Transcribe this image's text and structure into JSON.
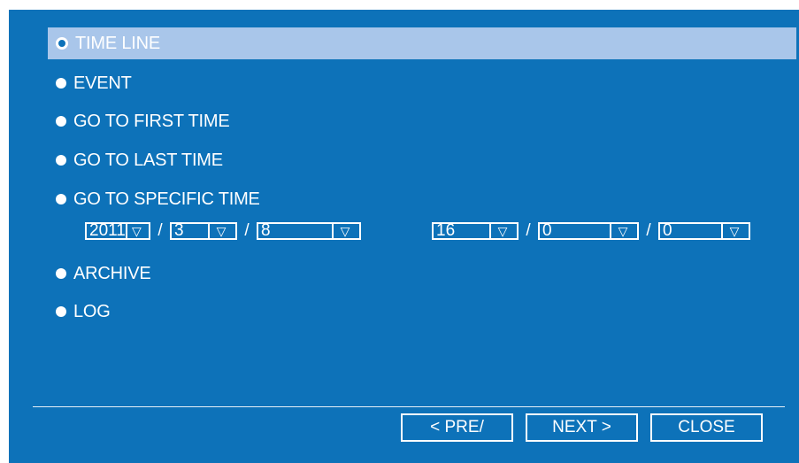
{
  "options": [
    {
      "label": "TIME LINE",
      "selected": true
    },
    {
      "label": "EVENT"
    },
    {
      "label": "GO TO FIRST TIME"
    },
    {
      "label": "GO TO LAST TIME"
    },
    {
      "label": "GO TO SPECIFIC TIME"
    },
    {
      "label": "ARCHIVE"
    },
    {
      "label": "LOG"
    }
  ],
  "date": {
    "year": "2011",
    "month": "3",
    "day": "8",
    "separator": "/"
  },
  "time": {
    "hour": "16",
    "minute": "0",
    "second": "0",
    "separator": "/"
  },
  "buttons": {
    "prev": "< PRE/",
    "next": "NEXT >",
    "close": "CLOSE"
  },
  "icons": {
    "dropdown": "triangle-down-icon",
    "radio": "radio-icon"
  },
  "colors": {
    "panel": "#0d72b9",
    "selected_row": "#a9c6ea",
    "text": "#ffffff"
  }
}
